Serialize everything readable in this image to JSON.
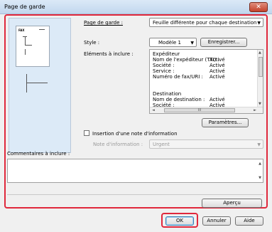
{
  "window": {
    "title": "Page de garde",
    "close_glyph": "✕"
  },
  "preview": {
    "fax_label": "FAX"
  },
  "form": {
    "cover_page": {
      "label": "Page de garde :",
      "value": "Feuille différente pour chaque destination"
    },
    "style": {
      "label": "Style :",
      "value": "Modèle 1",
      "save_button": "Enregistrer..."
    },
    "items": {
      "label": "Eléments à inclure :",
      "left_col": "Expéditeur\nNom de l'expéditeur (TTI) :\nSociété :\nService :\nNuméro de fax/URI :\n\n\nDestination\nNom de destination :\nSociété :",
      "right_col": "\nActivé\nActivé\nActivé\nActivé\n\n\n\nActivé\nActivé",
      "params_button": "Paramètres..."
    },
    "info_note": {
      "checkbox_label": "Insertion d'une note d'information",
      "note_label": "Note d'information :",
      "note_value": "Urgent"
    },
    "comments": {
      "label": "Commentaires à inclure :"
    },
    "preview_button": "Aperçu"
  },
  "footer": {
    "ok": "OK",
    "cancel": "Annuler",
    "help": "Aide"
  }
}
